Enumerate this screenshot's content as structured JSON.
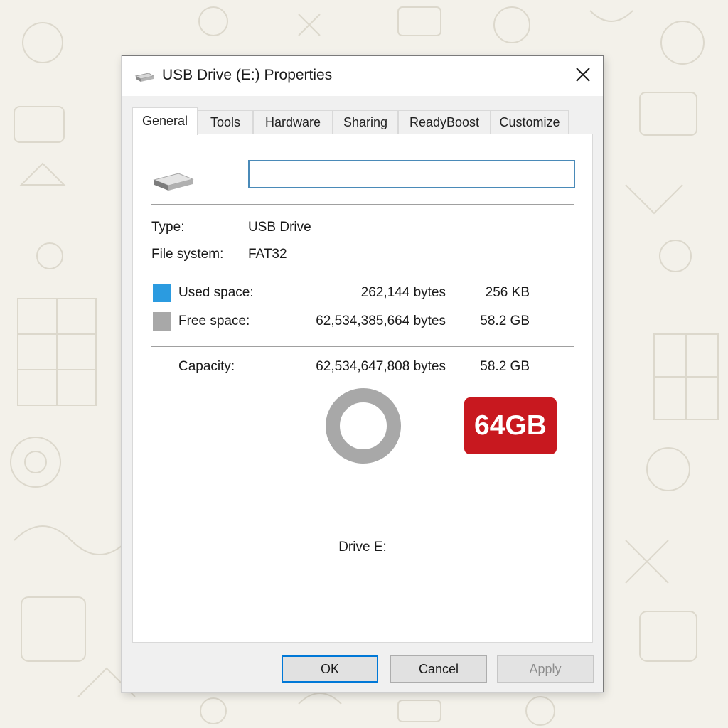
{
  "window": {
    "title": "USB Drive (E:) Properties",
    "icon": "usb-drive-icon",
    "close_icon": "close-icon"
  },
  "tabs": [
    {
      "label": "General",
      "active": true
    },
    {
      "label": "Tools",
      "active": false
    },
    {
      "label": "Hardware",
      "active": false
    },
    {
      "label": "Sharing",
      "active": false
    },
    {
      "label": "ReadyBoost",
      "active": false
    },
    {
      "label": "Customize",
      "active": false
    }
  ],
  "general": {
    "drive_name_value": "",
    "type_label": "Type:",
    "type_value": "USB Drive",
    "fs_label": "File system:",
    "fs_value": "FAT32",
    "used_label": "Used space:",
    "used_bytes": "262,144 bytes",
    "used_size": "256 KB",
    "free_label": "Free space:",
    "free_bytes": "62,534,385,664 bytes",
    "free_size": "58.2 GB",
    "capacity_label": "Capacity:",
    "capacity_bytes": "62,534,647,808 bytes",
    "capacity_size": "58.2 GB",
    "used_fraction": 4e-06,
    "drive_label": "Drive E:",
    "badge": "64GB"
  },
  "colors": {
    "used": "#2b9be0",
    "free": "#a8a8a8",
    "badge": "#c8181f",
    "focus": "#0078d7"
  },
  "buttons": {
    "ok": "OK",
    "cancel": "Cancel",
    "apply": "Apply"
  }
}
